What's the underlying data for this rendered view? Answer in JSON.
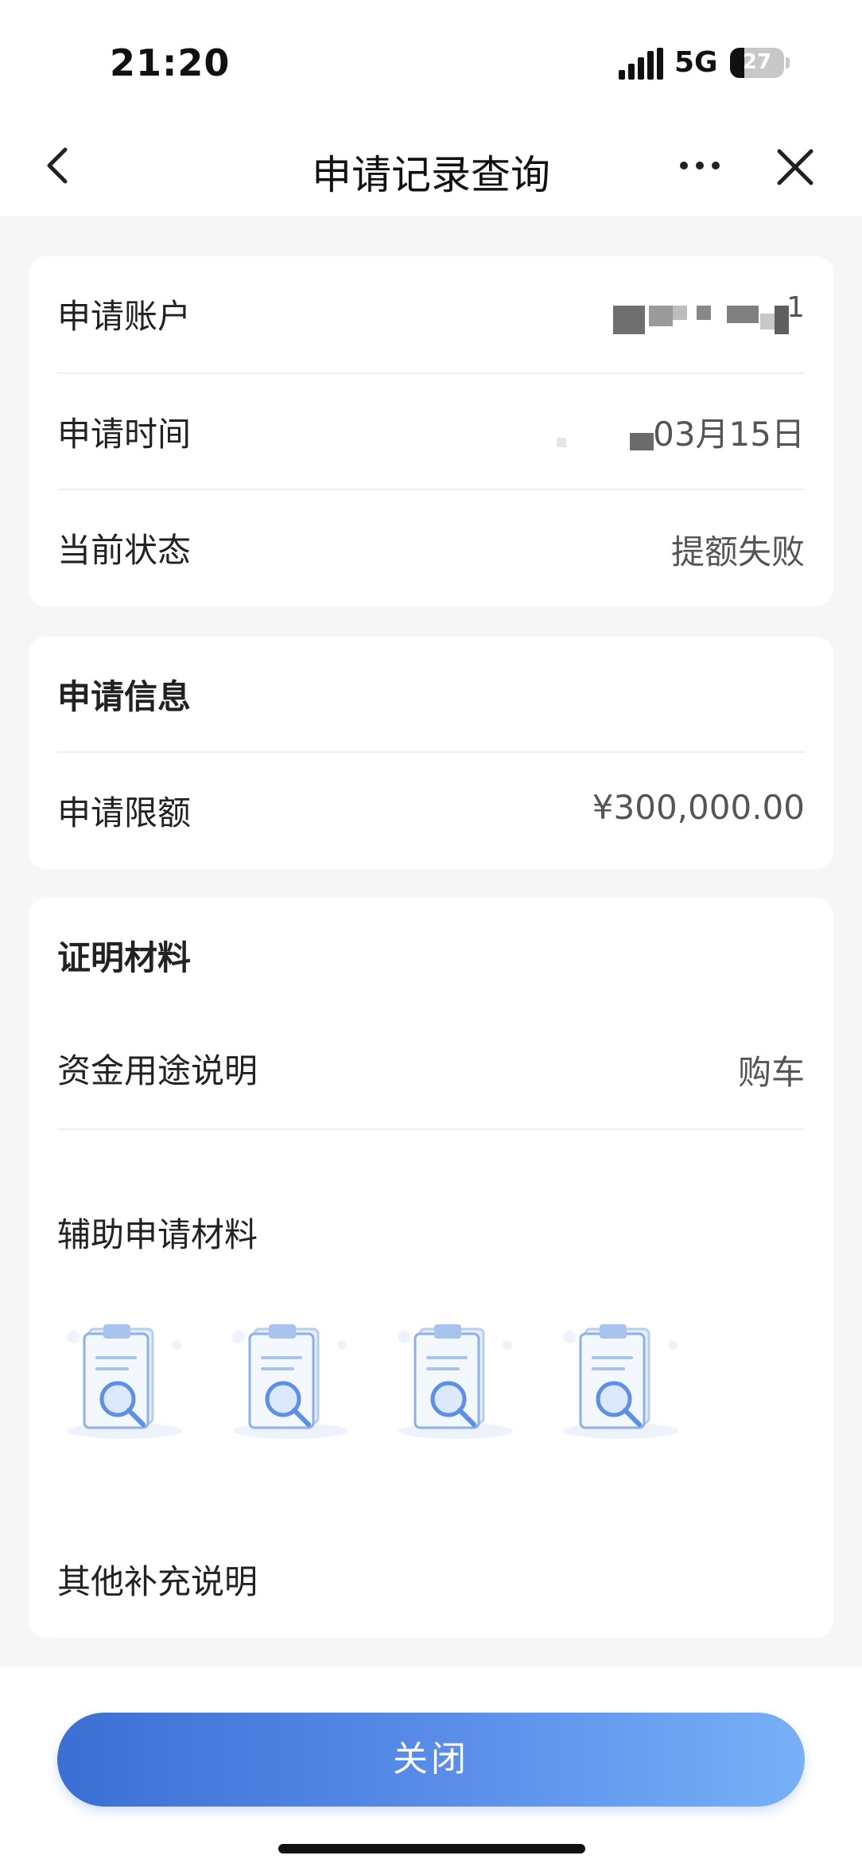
{
  "status_bar": {
    "time": "21:20",
    "network": "5G",
    "battery": "27"
  },
  "nav": {
    "title": "申请记录查询"
  },
  "basic_info": {
    "rows": [
      {
        "label": "申请账户",
        "value": "1"
      },
      {
        "label": "申请时间",
        "value": "03月15日"
      },
      {
        "label": "当前状态",
        "value": "提额失败"
      }
    ]
  },
  "apply_info": {
    "title": "申请信息",
    "limit_label": "申请限额",
    "limit_value": "¥300,000.00"
  },
  "materials": {
    "title": "证明材料",
    "purpose_label": "资金用途说明",
    "purpose_value": "购车",
    "aux_label": "辅助申请材料",
    "thumbnails": [
      "document-preview-icon",
      "document-preview-icon",
      "document-preview-icon",
      "document-preview-icon"
    ],
    "other_label": "其他补充说明"
  },
  "footer": {
    "close_label": "关闭"
  },
  "colors": {
    "accent_start": "#3c6fd3",
    "accent_end": "#77b0f7",
    "background": "#f6f6f7"
  }
}
